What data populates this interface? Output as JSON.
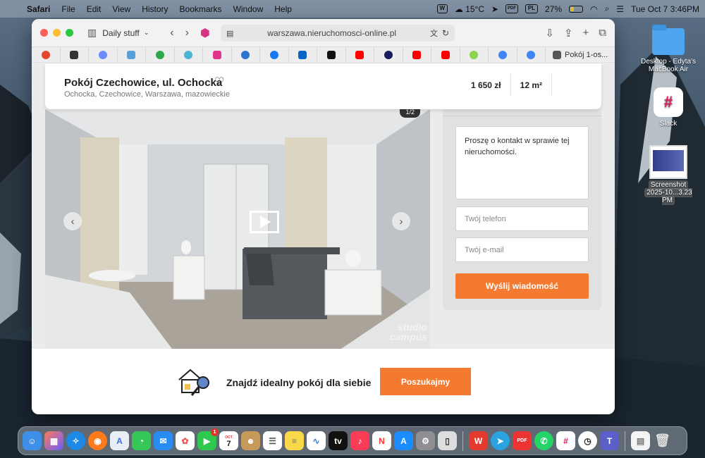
{
  "menubar": {
    "app": "Safari",
    "items": [
      "File",
      "Edit",
      "View",
      "History",
      "Bookmarks",
      "Window",
      "Help"
    ],
    "weather": "15°C",
    "pdf_label": "PDF",
    "input_source": "PL",
    "battery": "27%",
    "datetime": "Tue Oct 7  3:46PM"
  },
  "desktop": {
    "folder_label": "Desktop - Edyta's MacBook Air",
    "slack_label": "Slack",
    "screenshot_label_1": "Screenshot",
    "screenshot_label_2": "2025-10...3.23 PM"
  },
  "browser": {
    "tab_group": "Daily stuff",
    "url": "warszawa.nieruchomosci-online.pl",
    "last_tab": "Pokój 1-os..."
  },
  "listing": {
    "title": "Pokój Czechowice, ul. Ochocka",
    "location": "Ochocka, Czechowice, Warszawa, mazowieckie",
    "price": "1 650 zł",
    "area": "12 m²",
    "photo_counter": "1/2",
    "watermark_1": "studio",
    "watermark_2": "campus"
  },
  "contact": {
    "message": "Proszę o kontakt w sprawie tej nieruchomości.",
    "phone_placeholder": "Twój telefon",
    "email_placeholder": "Twój e-mail",
    "send_label": "Wyślij wiadomość"
  },
  "banner": {
    "text": "Znajdź idealny pokój dla siebie",
    "button": "Poszukajmy"
  },
  "dock": {
    "facetime_badge": "1",
    "calendar_month": "OCT",
    "calendar_day": "7"
  },
  "colors": {
    "accent": "#f47a2f",
    "close": "#ff5f57",
    "minimize": "#febc2e",
    "maximize": "#28c840"
  }
}
